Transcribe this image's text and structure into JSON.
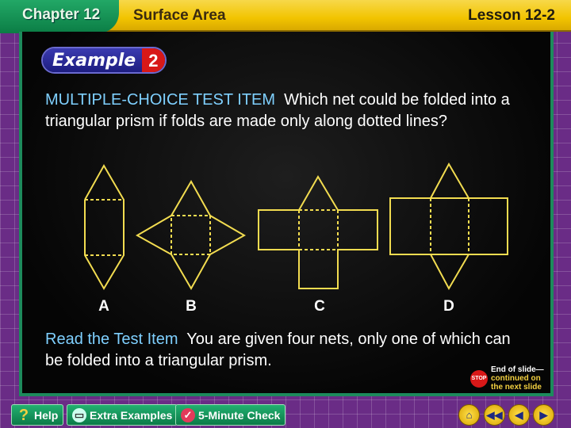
{
  "header": {
    "chapter": "Chapter 12",
    "topic": "Surface Area",
    "lesson": "Lesson 12-2"
  },
  "example": {
    "word": "Example",
    "number": "2"
  },
  "question": {
    "lead": "MULTIPLE-CHOICE TEST ITEM",
    "text": "Which net could be folded into a triangular prism if folds are made only along dotted lines?"
  },
  "nets": {
    "labels": [
      "A",
      "B",
      "C",
      "D"
    ],
    "line_color": "#f2dc50"
  },
  "read": {
    "lead": "Read the Test Item",
    "text": "You are given four nets, only one of which can be folded into a triangular prism."
  },
  "end_note": {
    "stop": "STOP",
    "line1": "End of slide—",
    "line2": "continued on",
    "line3": "the next slide"
  },
  "toolbar": {
    "help": "Help",
    "extra": "Extra Examples",
    "check": "5-Minute Check"
  },
  "nav": {
    "home": "home-icon",
    "first": "rewind-icon",
    "prev": "previous-icon",
    "next": "next-icon"
  }
}
